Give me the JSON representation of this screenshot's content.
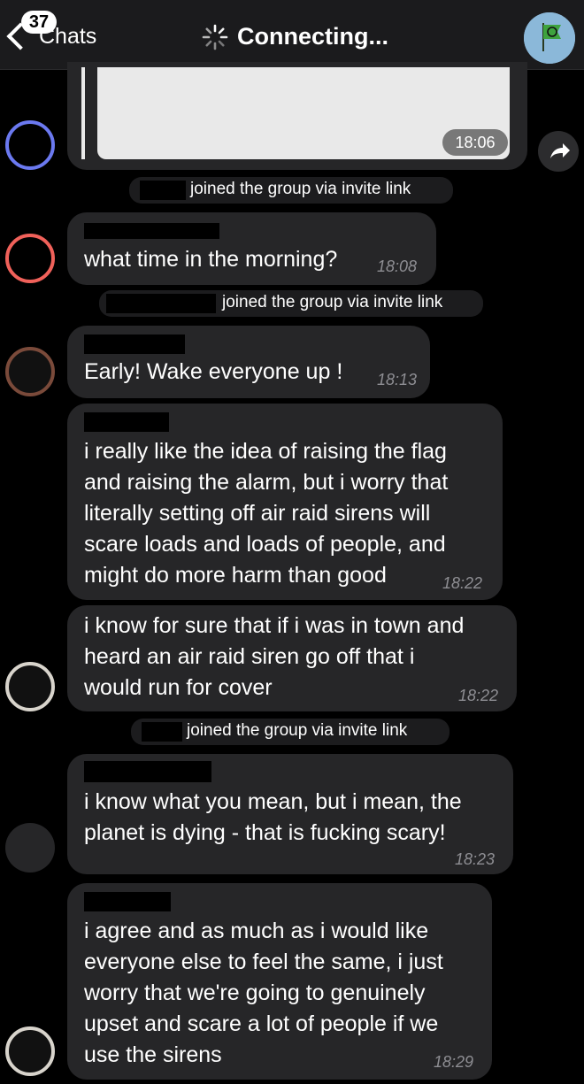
{
  "header": {
    "unread_count": "37",
    "back_label": "Chats",
    "title": "Connecting..."
  },
  "image_message": {
    "time": "18:06"
  },
  "service_messages": [
    "joined the group via invite link",
    "joined the group via invite link",
    "joined the group via invite link"
  ],
  "messages": [
    {
      "text": "what time in the morning?",
      "time": "18:08"
    },
    {
      "text": "Early! Wake everyone up !",
      "time": "18:13"
    },
    {
      "lines": [
        "i really like the idea of raising the flag",
        "and raising the alarm, but i worry that",
        "literally setting off air raid sirens will",
        "scare loads and loads of people, and",
        "might do more harm than good"
      ],
      "time": "18:22"
    },
    {
      "lines": [
        "i know for sure that if i was in town and",
        "heard an air raid siren go off that i",
        "would run for cover"
      ],
      "time": "18:22"
    },
    {
      "lines": [
        "i know what you mean, but i mean, the",
        "planet is dying - that is fucking scary!"
      ],
      "time": "18:23"
    },
    {
      "lines": [
        "i agree and as much as i would like",
        "everyone else to feel the same, i just",
        "worry that we're going to genuinely",
        "upset and scare a lot of people if we",
        "use the sirens"
      ],
      "time": "18:29"
    }
  ],
  "colors": {
    "avatar_1": "#6b79f0",
    "avatar_2": "#f0615a",
    "background": "#000000",
    "bubble": "#262628",
    "timestamp": "#8e8e93"
  }
}
